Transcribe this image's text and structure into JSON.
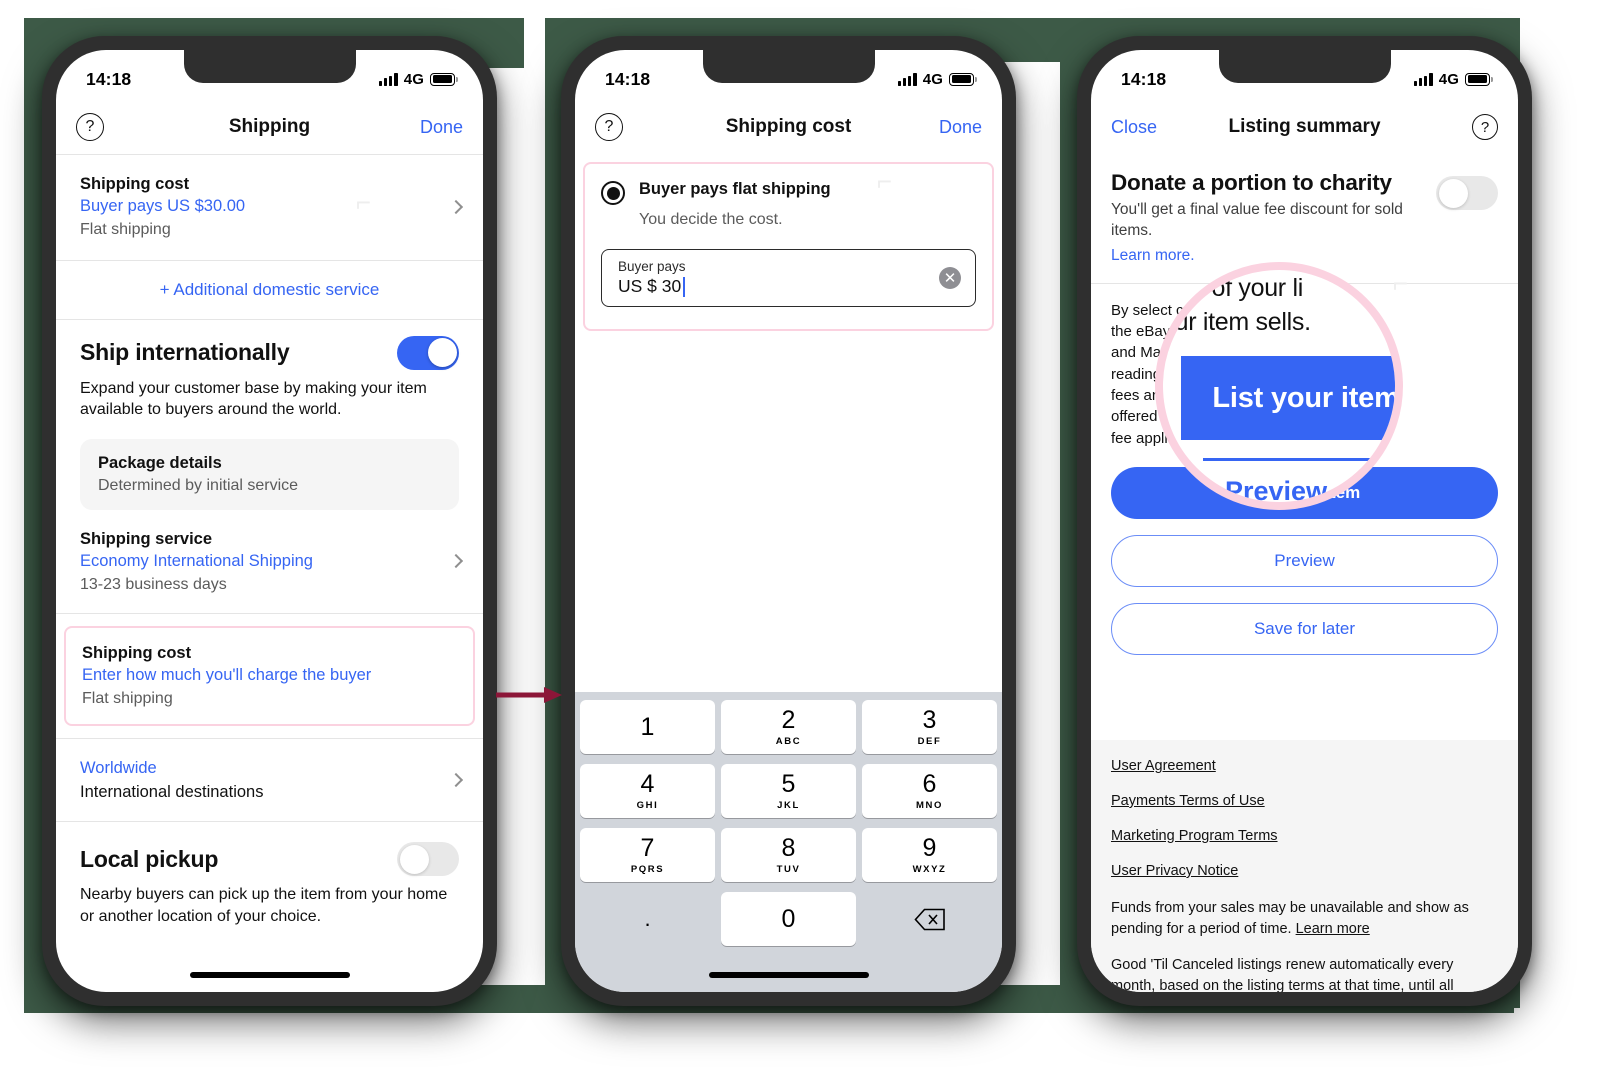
{
  "status_bar": {
    "time": "14:18",
    "network": "4G",
    "signal_icon": "signal-bars-icon",
    "battery_icon": "battery-icon"
  },
  "phone1": {
    "nav": {
      "help_icon": "help-circle-icon",
      "title": "Shipping",
      "action": "Done"
    },
    "shipping_cost_top": {
      "title": "Shipping cost",
      "link": "Buyer pays US $30.00",
      "sub": "Flat shipping",
      "chevron_icon": "chevron-right-icon"
    },
    "additional_service": "+ Additional domestic service",
    "ship_internationally": {
      "title": "Ship internationally",
      "body": "Expand your customer base by making your item available to buyers around the world.",
      "toggle_state": "on"
    },
    "package_details": {
      "title": "Package details",
      "sub": "Determined by initial service"
    },
    "shipping_service": {
      "title": "Shipping service",
      "link": "Economy International Shipping",
      "sub": "13-23 business days",
      "chevron_icon": "chevron-right-icon"
    },
    "shipping_cost_highlighted": {
      "title": "Shipping cost",
      "link": "Enter how much you'll charge the buyer",
      "sub": "Flat shipping",
      "chevron_icon": "chevron-right-icon"
    },
    "worldwide": {
      "link": "Worldwide",
      "sub": "International destinations",
      "chevron_icon": "chevron-right-icon"
    },
    "local_pickup": {
      "title": "Local pickup",
      "body": "Nearby buyers can pick up the item from your home or another location of your choice.",
      "toggle_state": "off"
    }
  },
  "phone2": {
    "nav": {
      "help_icon": "help-circle-icon",
      "title": "Shipping cost",
      "action": "Done"
    },
    "option": {
      "title": "Buyer pays flat shipping",
      "sub": "You decide the cost.",
      "radio_state": "selected"
    },
    "input": {
      "label": "Buyer pays",
      "value": "US $ 30",
      "clear_icon": "clear-circle-icon"
    },
    "keypad": {
      "keys": [
        {
          "num": "1",
          "sub": ""
        },
        {
          "num": "2",
          "sub": "ABC"
        },
        {
          "num": "3",
          "sub": "DEF"
        },
        {
          "num": "4",
          "sub": "GHI"
        },
        {
          "num": "5",
          "sub": "JKL"
        },
        {
          "num": "6",
          "sub": "MNO"
        },
        {
          "num": "7",
          "sub": "PQRS"
        },
        {
          "num": "8",
          "sub": "TUV"
        },
        {
          "num": "9",
          "sub": "WXYZ"
        }
      ],
      "decimal": ".",
      "zero": "0",
      "backspace_icon": "backspace-icon"
    }
  },
  "phone3": {
    "nav": {
      "close": "Close",
      "title": "Listing summary",
      "help_icon": "help-circle-icon"
    },
    "donate": {
      "title": "Donate a portion to charity",
      "sub": "You'll get a final value fee discount for sold items.",
      "link": "Learn more.",
      "toggle_state": "off"
    },
    "legal_lines": [
      "By select                      ccept",
      "the eBay                    s of Use",
      "and Mark                    ge",
      "reading th                  pplicable",
      "fees and as                 e item",
      "offered and t            A final value",
      "fee applies whe"
    ],
    "buttons": {
      "primary": "List your item",
      "preview": "Preview",
      "save": "Save for later"
    },
    "footer": {
      "links": [
        "User Agreement",
        "Payments Terms of Use",
        "Marketing Program Terms",
        "User Privacy Notice"
      ],
      "para1": "Funds from your sales may be unavailable and show as pending for a period of time. ",
      "para1_link": "Learn more",
      "para2": "Good 'Til Canceled listings renew automatically every month, based on the listing terms at that time, until all quantities sell or the listing ends. Each time a listing renews"
    }
  },
  "magnifier": {
    "line1": "ent of your li",
    "line2": "our item sells.",
    "button_label": "List your item",
    "preview_label": "Preview",
    "border_color": "#fbd2e0"
  },
  "annotation": {
    "arrow_icon": "arrow-right-icon",
    "arrow_color": "#8c1638",
    "highlight_color": "#fbd2e0"
  }
}
